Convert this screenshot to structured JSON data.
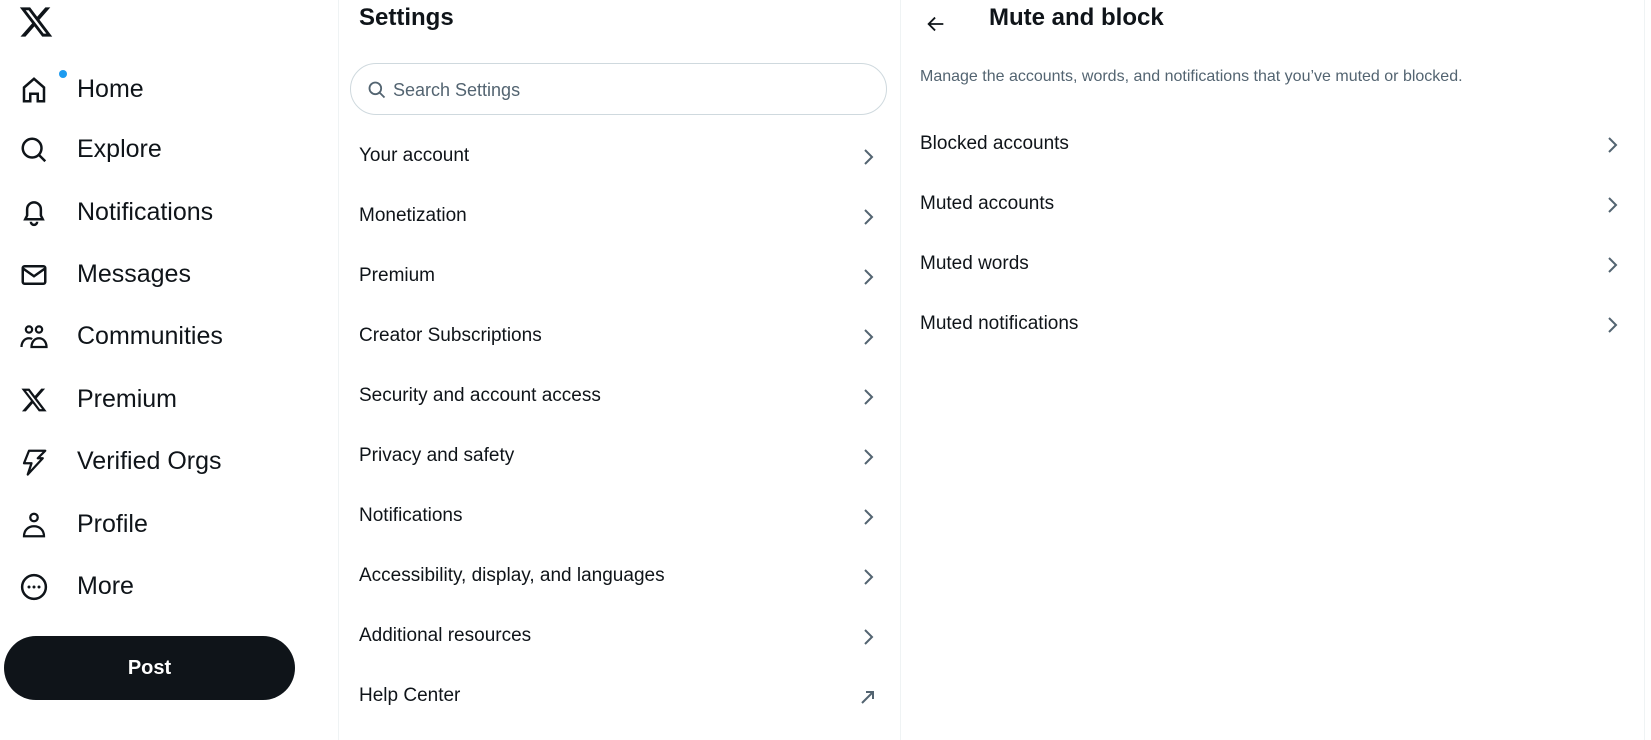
{
  "nav": {
    "logo": "x-logo",
    "items": [
      {
        "label": "Home",
        "icon": "home-icon",
        "badge_dot": true
      },
      {
        "label": "Explore",
        "icon": "search-icon"
      },
      {
        "label": "Notifications",
        "icon": "bell-icon"
      },
      {
        "label": "Messages",
        "icon": "envelope-icon"
      },
      {
        "label": "Communities",
        "icon": "people-icon"
      },
      {
        "label": "Premium",
        "icon": "x-logo-icon"
      },
      {
        "label": "Verified Orgs",
        "icon": "lightning-icon"
      },
      {
        "label": "Profile",
        "icon": "person-icon"
      },
      {
        "label": "More",
        "icon": "more-circle-icon"
      }
    ],
    "post_label": "Post",
    "accent_color": "#1d9bf0"
  },
  "settings": {
    "title": "Settings",
    "search_placeholder": "Search Settings",
    "search_value": "",
    "items": [
      {
        "label": "Your account",
        "icon": "chevron-right-icon"
      },
      {
        "label": "Monetization",
        "icon": "chevron-right-icon"
      },
      {
        "label": "Premium",
        "icon": "chevron-right-icon"
      },
      {
        "label": "Creator Subscriptions",
        "icon": "chevron-right-icon"
      },
      {
        "label": "Security and account access",
        "icon": "chevron-right-icon"
      },
      {
        "label": "Privacy and safety",
        "icon": "chevron-right-icon"
      },
      {
        "label": "Notifications",
        "icon": "chevron-right-icon"
      },
      {
        "label": "Accessibility, display, and languages",
        "icon": "chevron-right-icon"
      },
      {
        "label": "Additional resources",
        "icon": "chevron-right-icon"
      },
      {
        "label": "Help Center",
        "icon": "external-link-arrow-icon"
      }
    ]
  },
  "detail": {
    "title": "Mute and block",
    "description": "Manage the accounts, words, and notifications that you’ve muted or blocked.",
    "items": [
      {
        "label": "Blocked accounts"
      },
      {
        "label": "Muted accounts"
      },
      {
        "label": "Muted words"
      },
      {
        "label": "Muted notifications"
      }
    ]
  }
}
